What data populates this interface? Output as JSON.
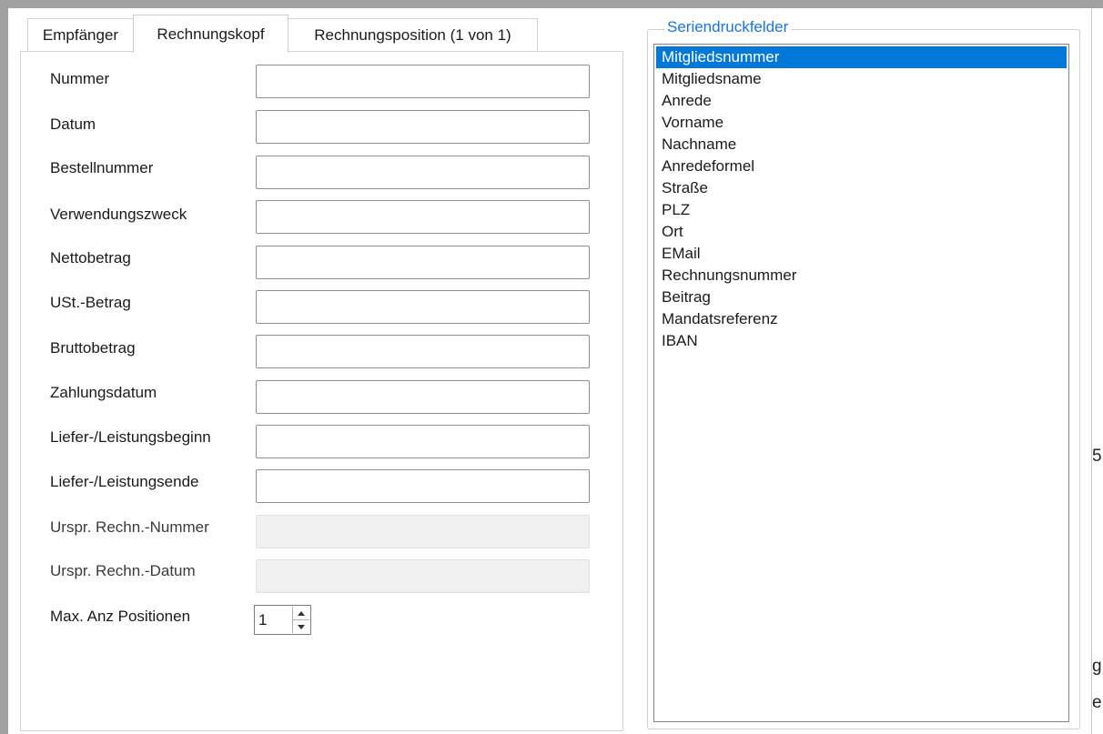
{
  "tabs": [
    {
      "label": "Empfänger",
      "active": false
    },
    {
      "label": "Rechnungskopf",
      "active": true
    },
    {
      "label": "Rechnungsposition (1 von 1)",
      "active": false
    }
  ],
  "form": {
    "fields": [
      {
        "label": "Nummer",
        "value": "",
        "enabled": true
      },
      {
        "label": "Datum",
        "value": "",
        "enabled": true
      },
      {
        "label": "Bestellnummer",
        "value": "",
        "enabled": true
      },
      {
        "label": "Verwendungszweck",
        "value": "",
        "enabled": true
      },
      {
        "label": "Nettobetrag",
        "value": "",
        "enabled": true
      },
      {
        "label": "USt.-Betrag",
        "value": "",
        "enabled": true
      },
      {
        "label": "Bruttobetrag",
        "value": "",
        "enabled": true
      },
      {
        "label": "Zahlungsdatum",
        "value": "",
        "enabled": true
      },
      {
        "label": "Liefer-/Leistungsbeginn",
        "value": "",
        "enabled": true
      },
      {
        "label": "Liefer-/Leistungsende",
        "value": "",
        "enabled": true
      },
      {
        "label": "Urspr. Rechn.-Nummer",
        "value": "",
        "enabled": false
      },
      {
        "label": "Urspr. Rechn.-Datum",
        "value": "",
        "enabled": false
      }
    ],
    "max_positions": {
      "label": "Max. Anz Positionen",
      "value": "1"
    }
  },
  "seriendruck": {
    "title": "Seriendruckfelder",
    "items": [
      "Mitgliedsnummer",
      "Mitgliedsname",
      "Anrede",
      "Vorname",
      "Nachname",
      "Anredeformel",
      "Straße",
      "PLZ",
      "Ort",
      "EMail",
      "Rechnungsnummer",
      "Beitrag",
      "Mandatsreferenz",
      "IBAN"
    ],
    "selected": "Mitgliedsnummer"
  },
  "clipped_text": [
    "5",
    "g",
    "e"
  ],
  "colors": {
    "accent": "#0078d7",
    "groupbox_title": "#1a73d9"
  }
}
